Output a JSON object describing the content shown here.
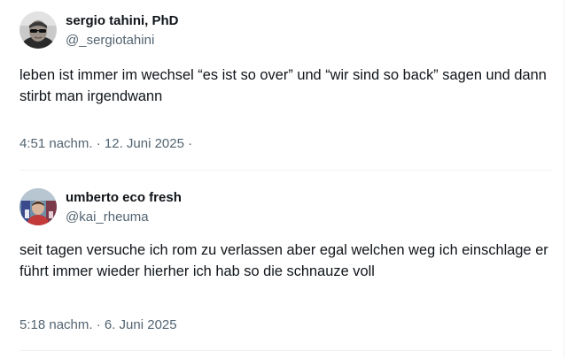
{
  "tweets": [
    {
      "author": {
        "name": "sergio tahini, PhD",
        "handle": "@_sergiotahini"
      },
      "text": "leben ist immer im wechsel “es ist so over” und “wir sind so back” sagen und dann stirbt man irgendwann",
      "meta": "4:51 nachm. · 12. Juni 2025 ·"
    },
    {
      "author": {
        "name": "umberto eco fresh",
        "handle": "@kai_rheuma"
      },
      "text": "seit tagen versuche ich rom zu verlassen aber egal welchen weg ich einschlage er führt immer wieder hierher ich hab so die schnauze voll",
      "meta": "5:18 nachm. · 6. Juni 2025"
    }
  ],
  "colors": {
    "text_primary": "#0f1419",
    "text_secondary": "#536471",
    "divider": "#eff3f4"
  }
}
